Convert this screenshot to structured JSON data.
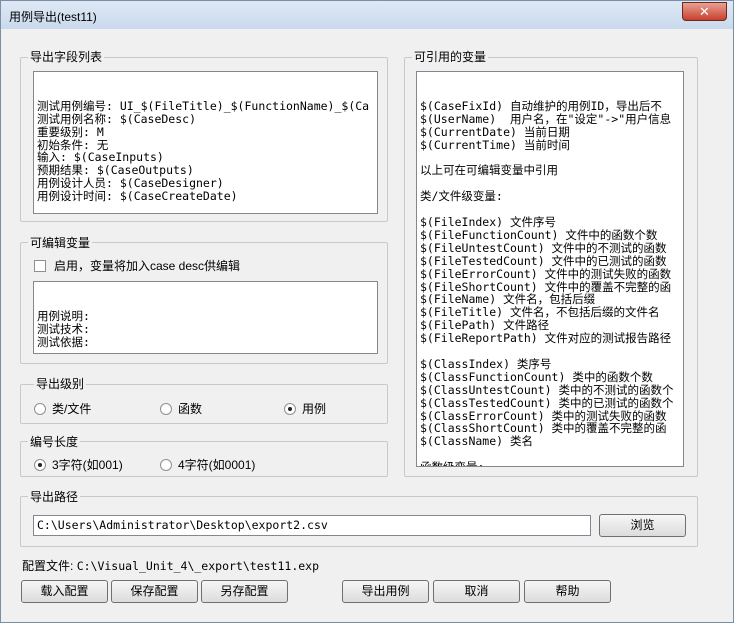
{
  "window": {
    "title": "用例导出(test11)",
    "close_label": "✕"
  },
  "fields_group": {
    "label": "导出字段列表",
    "lines": [
      "测试用例编号: UI_$(FileTitle)_$(FunctionName)_$(Ca",
      "测试用例名称: $(CaseDesc)",
      "重要级别: M",
      "初始条件: 无",
      "输入: $(CaseInputs)",
      "预期结果: $(CaseOutputs)",
      "用例设计人员: $(CaseDesigner)",
      "用例设计时间: $(CaseCreateDate)"
    ]
  },
  "editable_group": {
    "label": "可编辑变量",
    "enable_label": "启用，变量将加入case desc供编辑",
    "lines": [
      "用例说明:",
      "测试技术:",
      "测试依据:"
    ]
  },
  "export_level": {
    "label": "导出级别",
    "options": [
      {
        "label": "类/文件",
        "checked": false
      },
      {
        "label": "函数",
        "checked": false
      },
      {
        "label": "用例",
        "checked": true
      }
    ]
  },
  "id_length": {
    "label": "编号长度",
    "options": [
      {
        "label": "3字符(如001)",
        "checked": true
      },
      {
        "label": "4字符(如0001)",
        "checked": false
      }
    ]
  },
  "variables_group": {
    "label": "可引用的变量",
    "lines": [
      "$(CaseFixId) 自动维护的用例ID，导出后不",
      "$(UserName)  用户名，在\"设定\"->\"用户信息",
      "$(CurrentDate) 当前日期",
      "$(CurrentTime) 当前时间",
      "",
      "以上可在可编辑变量中引用",
      "",
      "类/文件级变量:",
      "",
      "$(FileIndex) 文件序号",
      "$(FileFunctionCount) 文件中的函数个数",
      "$(FileUntestCount) 文件中的不测试的函数",
      "$(FileTestedCount) 文件中的已测试的函数",
      "$(FileErrorCount) 文件中的测试失败的函数",
      "$(FileShortCount) 文件中的覆盖不完整的函",
      "$(FileName) 文件名，包括后缀",
      "$(FileTitle) 文件名，不包括后缀的文件名",
      "$(FilePath) 文件路径",
      "$(FileReportPath) 文件对应的测试报告路径",
      "",
      "$(ClassIndex) 类序号",
      "$(ClassFunctionCount) 类中的函数个数",
      "$(ClassUntestCount) 类中的不测试的函数个",
      "$(ClassTestedCount) 类中的已测试的函数个",
      "$(ClassErrorCount) 类中的测试失败的函数",
      "$(ClassShortCount) 类中的覆盖不完整的函",
      "$(ClassName) 类名",
      "",
      "函数级变量:"
    ]
  },
  "export_path": {
    "label": "导出路径",
    "value": "C:\\Users\\Administrator\\Desktop\\export2.csv",
    "browse_label": "浏览"
  },
  "config_file": {
    "prefix": "配置文件:",
    "value": "C:\\Visual_Unit_4\\_export\\test11.exp"
  },
  "buttons": {
    "load": "载入配置",
    "save": "保存配置",
    "save_as": "另存配置",
    "export": "导出用例",
    "cancel": "取消",
    "help": "帮助"
  }
}
